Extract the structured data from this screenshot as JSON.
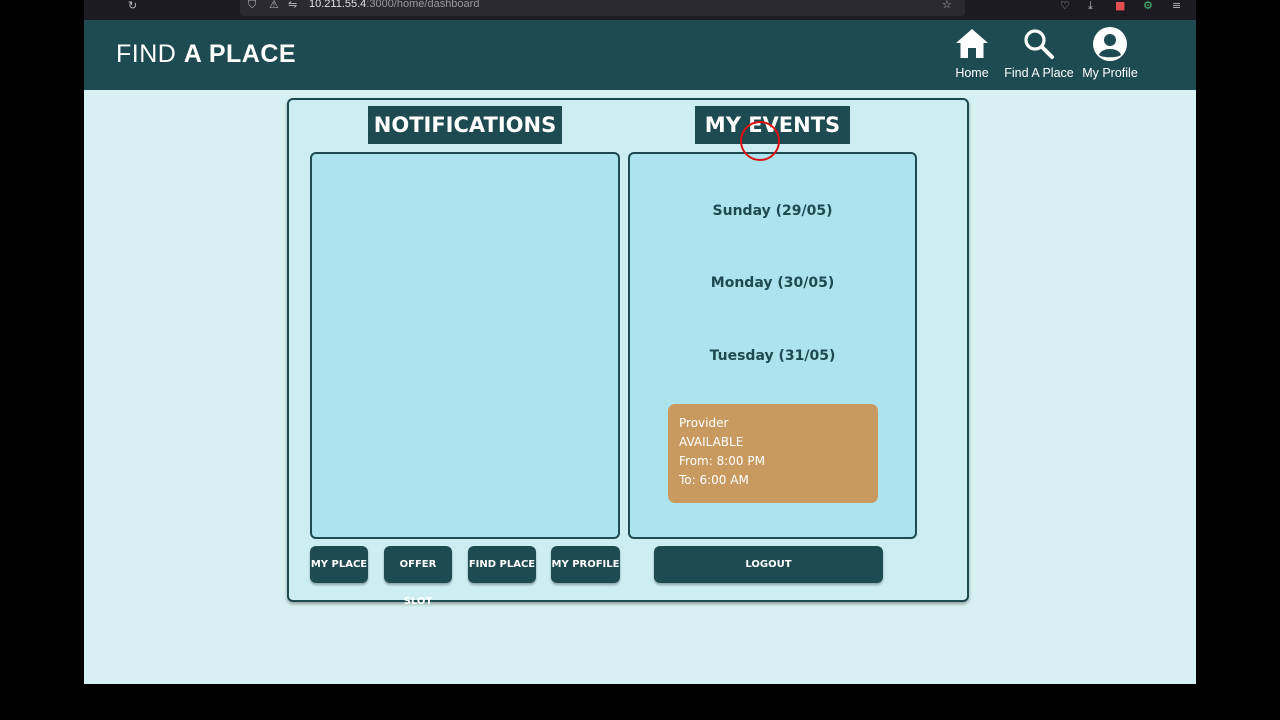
{
  "browser": {
    "url_host": "10.211.55.4",
    "url_path": ":3000/home/dashboard"
  },
  "header": {
    "brand_light": "FIND ",
    "brand_bold": "A PLACE",
    "nav": [
      {
        "label": "Home",
        "icon": "home-icon"
      },
      {
        "label": "Find A Place",
        "icon": "search-icon"
      },
      {
        "label": "My Profile",
        "icon": "user-icon"
      }
    ]
  },
  "notifications": {
    "title": "NOTIFICATIONS",
    "items": []
  },
  "events": {
    "title": "MY EVENTS",
    "days": [
      "Sunday (29/05)",
      "Monday (30/05)",
      "Tuesday (31/05)"
    ],
    "slot": {
      "line1": "Provider",
      "line2": "AVAILABLE",
      "line3": "From: 8:00 PM",
      "line4": "To: 6:00 AM"
    }
  },
  "actions": {
    "my_place": "MY PLACE",
    "offer_slot": "OFFER SLOT",
    "find_place": "FIND PLACE",
    "my_profile": "MY PROFILE",
    "logout": "LOGOUT"
  },
  "colors": {
    "primary": "#1e4a52",
    "panel": "#ade3ec",
    "card": "#cceef3",
    "background": "#d7f1f2",
    "slot": "#c99a5f"
  }
}
